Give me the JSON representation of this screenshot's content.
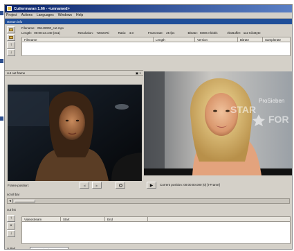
{
  "window": {
    "title": "Cuttermaran 1.66 - <unnamed>"
  },
  "menu": [
    "Project",
    "Actions",
    "Languages",
    "Windows",
    "Help"
  ],
  "stream_info": {
    "panel_title": "stream info",
    "filename_label": "Filename:",
    "filename_value": "05149000_cut.mpv",
    "length_label": "Length:",
    "length_value": "00:00:13.440 (311)",
    "resolution_label": "Resolution:",
    "resolution_value": "720x576i",
    "ratio_label": "Ratio:",
    "ratio_value": "4:3",
    "framerate_label": "Framerate:",
    "framerate_value": "25 fps",
    "bitrate_label": "Bitrate:",
    "bitrate_value": "5000.0 kbit/s",
    "vbv_label": "vbvBuffer:",
    "vbv_value": "112 KiloByte",
    "columns": [
      "Filename",
      "Length",
      "Version",
      "Bitrate",
      "Samplerate"
    ]
  },
  "cut_out_frame": {
    "panel_title": "cut out frame",
    "frame_position_label": "Frame position:",
    "current_position": "Current position: 00:00:00.000 (0) [I-Frame]"
  },
  "scroll": {
    "label": "scroll bar"
  },
  "cut_list": {
    "label": "cut list",
    "columns": [
      "Videostream",
      "Start",
      "End"
    ]
  },
  "status": {
    "label": "cutted",
    "input_placeholder": "(unnamed cut)"
  },
  "overlay": {
    "logo_line1": "ProSieben",
    "logo_line2": "STAR",
    "logo_line3": "FOR"
  },
  "colors": {
    "titlebar": "#0a246a",
    "panel_title": "#1f4e99",
    "chrome": "#d4d0c8"
  }
}
